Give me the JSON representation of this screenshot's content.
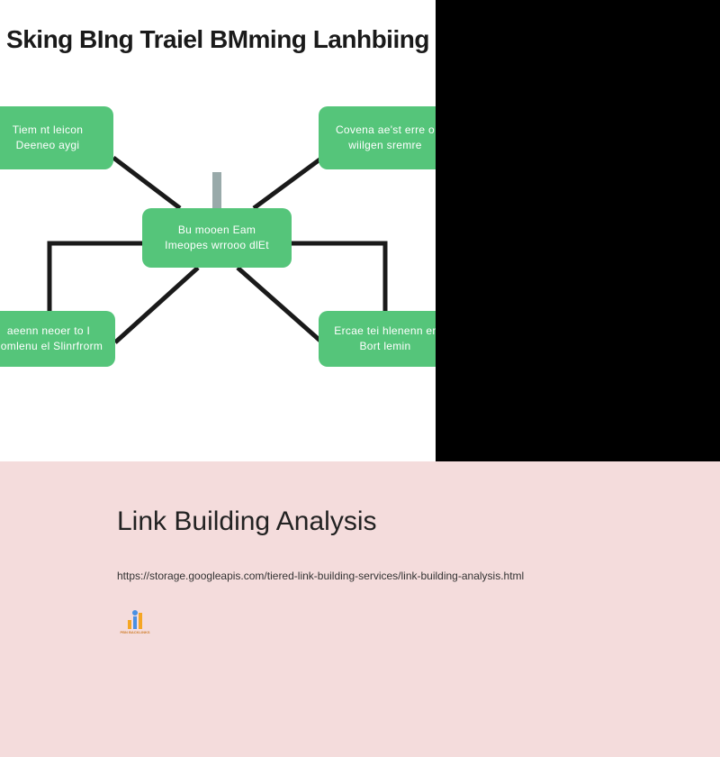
{
  "diagram": {
    "title": "Sking BIng Traiel BMming Lanhbiing",
    "center": {
      "line1": "Bu mooen Eam",
      "line2": "Imeopes wrrooo dlEt"
    },
    "top_left": {
      "line1": "Tiem nt leicon",
      "line2": "Deeneo aygi"
    },
    "top_right": {
      "line1": "Covena ae'st erre o",
      "line2": "wiilgen sremre"
    },
    "bottom_left": {
      "line1": "aeenn neoer to I",
      "line2": "nomlenu el Slinrfrorm"
    },
    "bottom_right": {
      "line1": "Ercae tei hlenenn er",
      "line2": "Bort lemin"
    }
  },
  "page": {
    "title": "Link Building Analysis",
    "url": "https://storage.googleapis.com/tiered-link-building-services/link-building-analysis.html",
    "logo_text": "PBN BACKLINKS"
  },
  "colors": {
    "box_green": "#55c57a",
    "page_bg": "#f4dcdc"
  }
}
